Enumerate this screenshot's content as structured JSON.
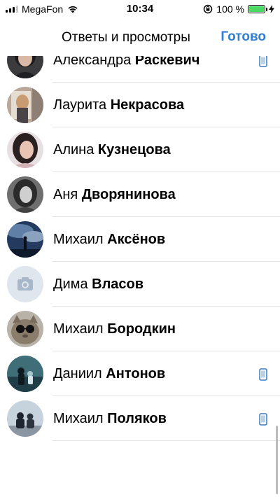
{
  "status_bar": {
    "carrier": "MegaFon",
    "time": "10:34",
    "battery": "100 %"
  },
  "nav": {
    "title": "Ответы и просмотры",
    "done": "Готово"
  },
  "people": [
    {
      "first": "Александра",
      "last": "Раскевич",
      "avatar": "photo-dark-hair-girl",
      "mobile": true
    },
    {
      "first": "Лаурита",
      "last": "Некрасова",
      "avatar": "photo-blonde-girl-mirror",
      "mobile": false
    },
    {
      "first": "Алина",
      "last": "Кузнецова",
      "avatar": "photo-girl-dark-hair",
      "mobile": false
    },
    {
      "first": "Аня",
      "last": "Дворянинова",
      "avatar": "photo-girl-bw",
      "mobile": false
    },
    {
      "first": "Михаил",
      "last": "Аксёнов",
      "avatar": "photo-silhouette-storm",
      "mobile": false
    },
    {
      "first": "Дима",
      "last": "Власов",
      "avatar": "camera-placeholder",
      "mobile": false
    },
    {
      "first": "Михаил",
      "last": "Бородкин",
      "avatar": "photo-cat-sunglasses",
      "mobile": false
    },
    {
      "first": "Даниил",
      "last": "Антонов",
      "avatar": "photo-teal-figure",
      "mobile": true
    },
    {
      "first": "Михаил",
      "last": "Поляков",
      "avatar": "photo-two-people",
      "mobile": true
    }
  ],
  "colors": {
    "accent": "#2f7fd6",
    "battery": "#4cd964"
  }
}
